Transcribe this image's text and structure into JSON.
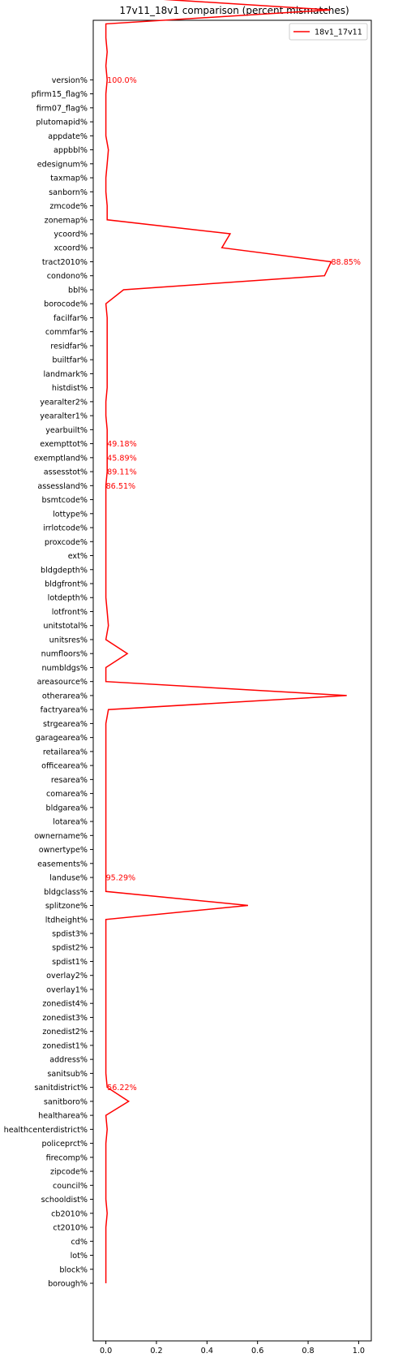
{
  "chart_data": {
    "type": "line",
    "title": "17v11_18v1 comparison (percent mismatches)",
    "xlabel": "",
    "ylabel": "",
    "xlim": [
      -0.05,
      1.05
    ],
    "xticks": [
      0.0,
      0.2,
      0.4,
      0.6,
      0.8,
      1.0
    ],
    "xtick_labels": [
      "0.0",
      "0.2",
      "0.4",
      "0.6",
      "0.8",
      "1.0"
    ],
    "grid": false,
    "legend_position": "top-right",
    "series": [
      {
        "name": "18v1_17v11",
        "color": "#ff0000",
        "values": [
          0,
          0,
          0,
          0,
          0,
          0.005,
          0,
          0,
          0,
          0,
          0,
          0.005,
          0,
          0.09,
          0.005,
          0,
          0,
          0,
          0,
          0,
          0,
          0,
          0,
          0,
          0,
          0,
          0,
          0.5622,
          0,
          0,
          0,
          0,
          0,
          0,
          0,
          0,
          0,
          0,
          0,
          0,
          0,
          0.01,
          0.9529,
          0,
          0,
          0.085,
          0,
          0.01,
          0.005,
          0,
          0,
          0,
          0,
          0,
          0,
          0,
          0,
          0,
          0.005,
          0.005,
          0.005,
          0.005,
          0,
          0,
          0.005,
          0.005,
          0.005,
          0.005,
          0.005,
          0.005,
          0,
          0.07,
          0.8651,
          0.8911,
          0.4589,
          0.4918,
          0.005,
          0.005,
          0,
          0,
          0.005,
          0.01,
          0,
          0,
          0,
          0,
          0.005,
          0,
          0.005,
          0,
          0,
          0.8885,
          0.005,
          0.005,
          0.005,
          0.005,
          0.005,
          0.005,
          0.005,
          0,
          0.005,
          0.08,
          0,
          0,
          0,
          1.0
        ]
      }
    ],
    "categories": [
      "borough%",
      "block%",
      "lot%",
      "cd%",
      "ct2010%",
      "cb2010%",
      "schooldist%",
      "council%",
      "zipcode%",
      "firecomp%",
      "policeprct%",
      "healthcenterdistrict%",
      "healtharea%",
      "sanitboro%",
      "sanitdistrict%",
      "sanitsub%",
      "address%",
      "zonedist1%",
      "zonedist2%",
      "zonedist3%",
      "zonedist4%",
      "overlay1%",
      "overlay2%",
      "spdist1%",
      "spdist2%",
      "spdist3%",
      "ltdheight%",
      "splitzone%",
      "bldgclass%",
      "landuse%",
      "easements%",
      "ownertype%",
      "ownername%",
      "lotarea%",
      "bldgarea%",
      "comarea%",
      "resarea%",
      "officearea%",
      "retailarea%",
      "garagearea%",
      "strgearea%",
      "factryarea%",
      "otherarea%",
      "areasource%",
      "numbldgs%",
      "numfloors%",
      "unitsres%",
      "unitstotal%",
      "lotfront%",
      "lotdepth%",
      "bldgfront%",
      "bldgdepth%",
      "ext%",
      "proxcode%",
      "irrlotcode%",
      "lottype%",
      "bsmtcode%",
      "assessland%",
      "assesstot%",
      "exemptland%",
      "exempttot%",
      "yearbuilt%",
      "yearalter1%",
      "yearalter2%",
      "histdist%",
      "landmark%",
      "builtfar%",
      "residfar%",
      "commfar%",
      "facilfar%",
      "borocode%",
      "bbl%",
      "condono%",
      "tract2010%",
      "xcoord%",
      "ycoord%",
      "zonemap%",
      "zmcode%",
      "sanborn%",
      "taxmap%",
      "edesignum%",
      "appbbl%",
      "appdate%",
      "plutomapid%",
      "firm07_flag%",
      "pfirm15_flag%",
      "version%"
    ],
    "annotations": [
      {
        "index": 86,
        "label": "100.0%"
      },
      {
        "index": 73,
        "label": "88.85%"
      },
      {
        "index": 60,
        "label": "49.18%"
      },
      {
        "index": 59,
        "label": "45.89%"
      },
      {
        "index": 58,
        "label": "89.11%"
      },
      {
        "index": 57,
        "label": "86.51%"
      },
      {
        "index": 29,
        "label": "95.29%"
      },
      {
        "index": 14,
        "label": "56.22%"
      }
    ],
    "annotation_color": "#ff0000"
  }
}
